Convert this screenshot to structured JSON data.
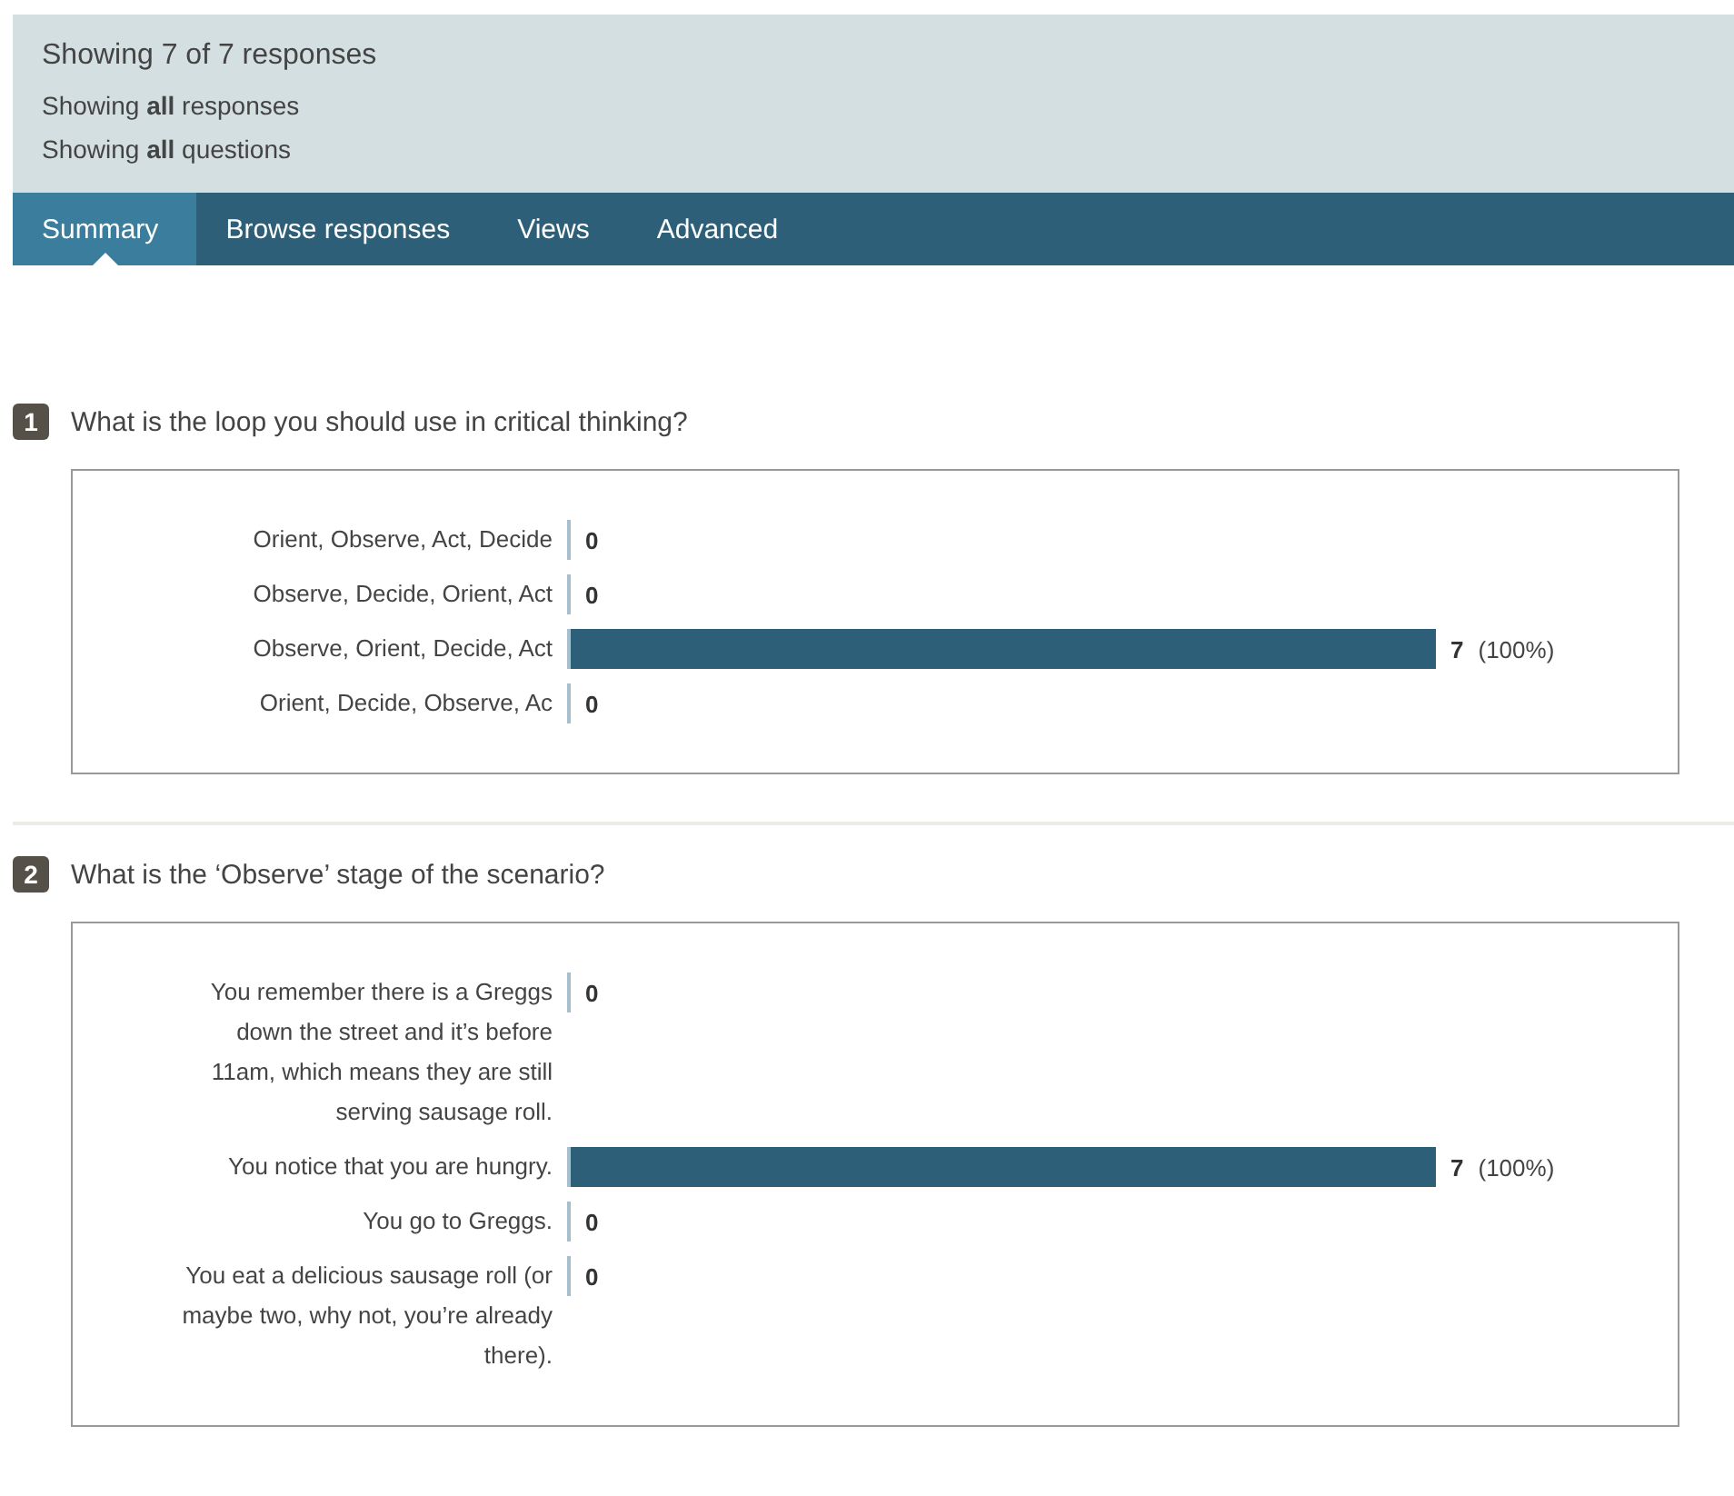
{
  "header": {
    "title": "Showing 7 of 7 responses",
    "filters": [
      "Showing **all** responses",
      "Showing **all** questions"
    ]
  },
  "tabs": [
    {
      "label": "Summary",
      "selected": true
    },
    {
      "label": "Browse responses",
      "selected": false
    },
    {
      "label": "Views",
      "selected": false
    },
    {
      "label": "Advanced",
      "selected": false
    }
  ],
  "questions": [
    {
      "number": "1",
      "text": "What is the loop you should use in critical thinking?",
      "answers": [
        {
          "label": "Orient, Observe, Act, Decide",
          "count": "0"
        },
        {
          "label": "Observe, Decide, Orient, Act",
          "count": "0"
        },
        {
          "label": "Observe, Orient, Decide, Act",
          "count": "7",
          "percent": "(100%)",
          "level": 1
        },
        {
          "label": "Orient, Decide, Observe, Ac",
          "count": "0"
        }
      ]
    },
    {
      "number": "2",
      "text": "What is the ‘Observe’ stage of the scenario?",
      "answers": [
        {
          "label": "You remember there is a Greggs down the street and it’s before 11am, which means they are still serving sausage roll.",
          "count": "0"
        },
        {
          "label": "You notice that you are hungry.",
          "count": "7",
          "percent": "(100%)",
          "level": 1
        },
        {
          "label": "You go to Greggs.",
          "count": "0"
        },
        {
          "label": "You eat a delicious sausage roll (or maybe two, why not, you’re already there).",
          "count": "0"
        }
      ]
    }
  ]
}
